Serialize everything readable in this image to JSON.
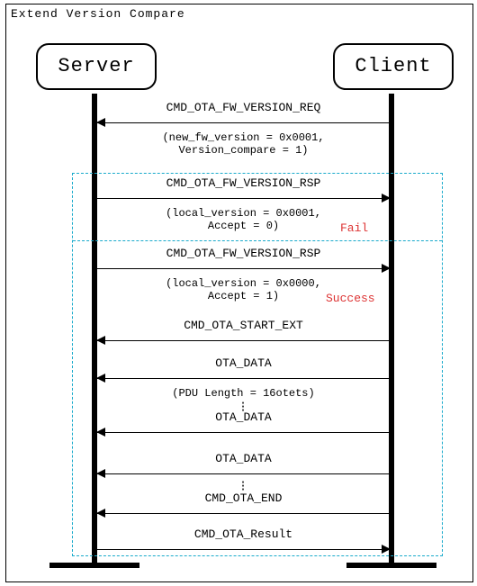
{
  "title": "Extend Version Compare",
  "actors": {
    "server": "Server",
    "client": "Client"
  },
  "messages": {
    "m1": {
      "label": "CMD_OTA_FW_VERSION_REQ",
      "sub": "(new_fw_version = 0x0001,\nVersion_compare = 1)",
      "dir": "left"
    },
    "m2": {
      "label": "CMD_OTA_FW_VERSION_RSP",
      "sub": "(local_version = 0x0001,\nAccept = 0)",
      "dir": "right",
      "anno": "Fail"
    },
    "m3": {
      "label": "CMD_OTA_FW_VERSION_RSP",
      "sub": "(local_version = 0x0000,\nAccept = 1)",
      "dir": "right",
      "anno": "Success"
    },
    "m4": {
      "label": "CMD_OTA_START_EXT",
      "dir": "left"
    },
    "m5": {
      "label": "OTA_DATA",
      "sub": "(PDU Length = 16otets)",
      "dir": "left"
    },
    "m6": {
      "label": "OTA_DATA",
      "dir": "left"
    },
    "m7": {
      "label": "OTA_DATA",
      "dir": "left"
    },
    "m8": {
      "label": "CMD_OTA_END",
      "dir": "left"
    },
    "m9": {
      "label": "CMD_OTA_Result",
      "dir": "right"
    }
  }
}
